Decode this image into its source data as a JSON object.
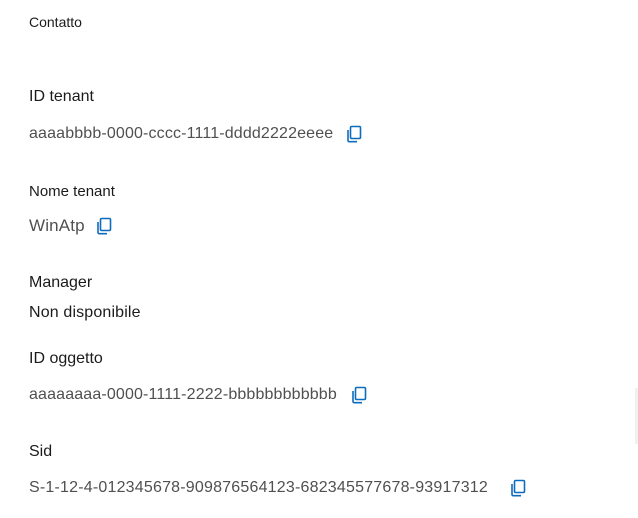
{
  "section": {
    "title": "Contatto"
  },
  "fields": {
    "tenant_id": {
      "label": "ID tenant",
      "value": "aaaabbbb-0000-cccc-1111-dddd2222eeee"
    },
    "tenant_name": {
      "label": "Nome tenant",
      "value": "WinAtp"
    },
    "manager": {
      "label": "Manager",
      "value": "Non disponibile"
    },
    "object_id": {
      "label": "ID oggetto",
      "value": "aaaaaaaa-0000-1111-2222-bbbbbbbbbbbb"
    },
    "sid": {
      "label": "Sid",
      "value": "S-1-12-4-012345678-909876564123-682345577678-93917312"
    }
  },
  "icons": {
    "copy": "copy-icon"
  },
  "colors": {
    "icon_accent": "#0f6cbd",
    "label_text": "#1b1b1b",
    "value_text": "#505050"
  }
}
